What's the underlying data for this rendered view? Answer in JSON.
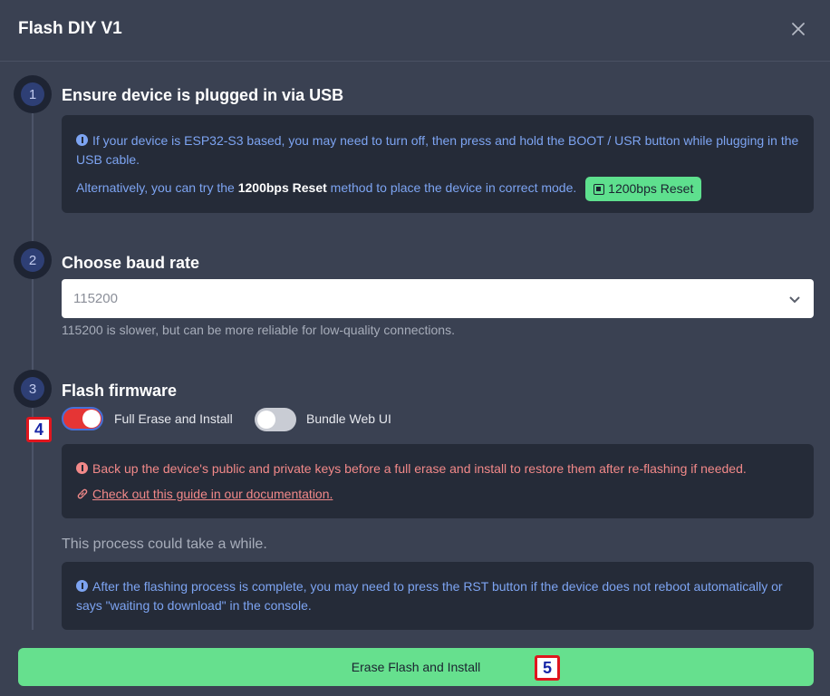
{
  "dialog": {
    "title": "Flash DIY V1",
    "close_icon": "close-icon"
  },
  "steps": [
    {
      "number": "1",
      "title": "Ensure device is plugged in via USB",
      "info_line1": "If your device is ESP32-S3 based, you may need to turn off, then press and hold the BOOT / USR button while plugging in the USB cable.",
      "alt_prefix": "Alternatively, you can try the ",
      "alt_bold": "1200bps Reset",
      "alt_suffix": " method to place the device in correct mode.",
      "reset_button": "1200bps Reset",
      "reset_icon": "chip-icon"
    },
    {
      "number": "2",
      "title": "Choose baud rate",
      "baud_value": "115200",
      "hint": "115200 is slower, but can be more reliable for low-quality connections."
    },
    {
      "number": "3",
      "title": "Flash firmware",
      "toggle_full_erase": {
        "label": "Full Erase and Install",
        "on": true
      },
      "toggle_bundle_web_ui": {
        "label": "Bundle Web UI",
        "on": false
      },
      "warning": "Back up the device's public and private keys before a full erase and install to restore them after re-flashing if needed.",
      "guide_link": "Check out this guide in our documentation.",
      "process_note": "This process could take a while.",
      "post_info": "After the flashing process is complete, you may need to press the RST button if the device does not reboot automatically or says \"waiting to download\" in the console."
    }
  ],
  "primary_button": "Erase Flash and Install",
  "annotations": {
    "marker_a": "4",
    "marker_b": "5"
  },
  "colors": {
    "background": "#3a4152",
    "panel": "#252b38",
    "accent_green": "#66e08e",
    "toggle_on": "#e53535",
    "info_blue": "#7da4f2",
    "warning_red": "#f28989"
  }
}
